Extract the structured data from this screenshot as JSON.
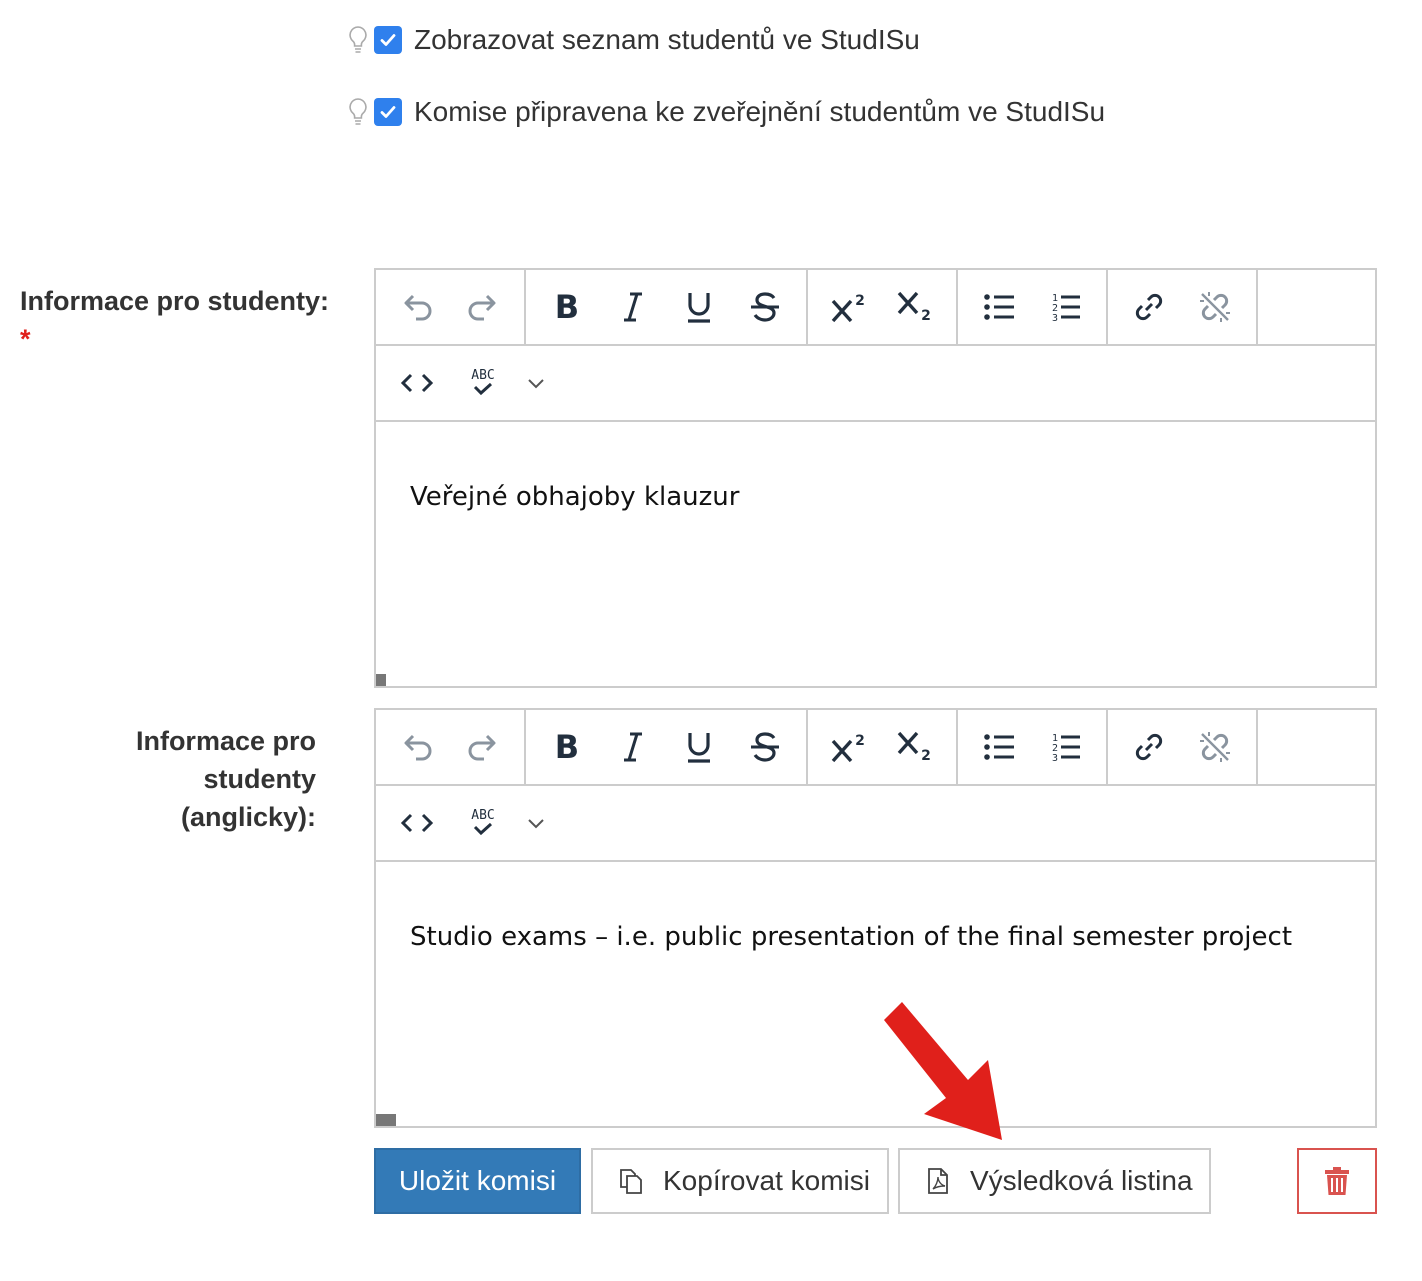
{
  "checkboxes": [
    {
      "label": "Zobrazovat seznam studentů ve StudISu",
      "checked": true
    },
    {
      "label": "Komise připravena ke zveřejnění studentům ve StudISu",
      "checked": true
    }
  ],
  "fields": {
    "info_cs": {
      "label": "Informace pro studenty:",
      "required_mark": "*",
      "content": "Veřejné obhajoby klauzur"
    },
    "info_en": {
      "label_line1": "Informace pro studenty",
      "label_line2": "(anglicky):",
      "content": "Studio exams – i.e. public presentation of the final semester project"
    }
  },
  "toolbar": {
    "spellcheck_label": "ABC"
  },
  "buttons": {
    "save": "Uložit komisi",
    "copy": "Kopírovat komisi",
    "results": "Výsledková listina"
  },
  "colors": {
    "primary": "#337ab7",
    "checkbox": "#2f80ed",
    "danger": "#d9534f",
    "arrow": "#e0201b"
  }
}
